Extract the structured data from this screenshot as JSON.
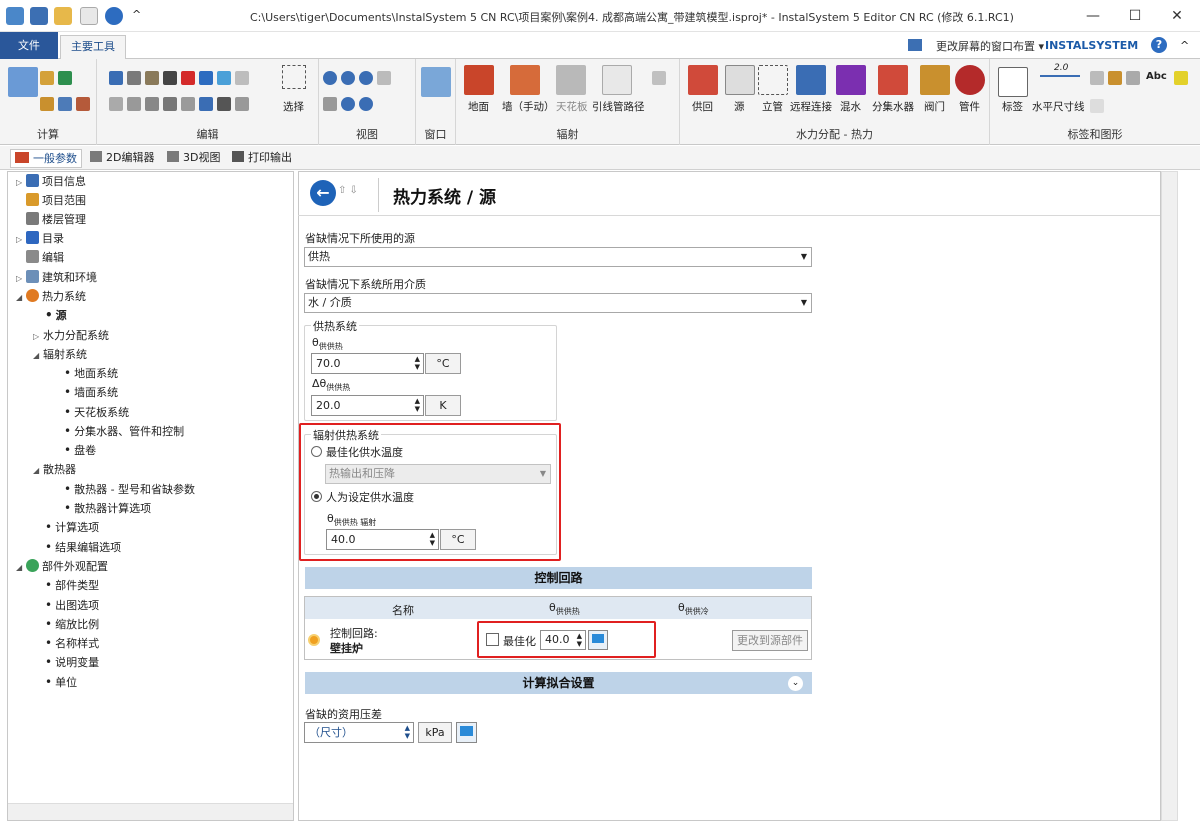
{
  "window": {
    "title": "C:\\Users\\tiger\\Documents\\InstalSystem 5 CN RC\\项目案例\\案例4. 成都高端公寓_带建筑模型.isproj* - InstalSystem 5 Editor CN RC (修改 6.1.RC1)",
    "minimize": "—",
    "maximize": "☐",
    "close": "✕"
  },
  "ribbon_tabs": {
    "file": "文件",
    "main": "主要工具"
  },
  "topright": {
    "layout": "更改屏幕的窗口布置 ▾",
    "logo": "INSTALSYSTEM",
    "help": "?",
    "collapse": "^"
  },
  "ribbon": {
    "groups": [
      "计算",
      "编辑",
      "视图",
      "窗口",
      "辐射",
      "水力分配 - 热力",
      "标签和图形"
    ],
    "edit_select": "选择",
    "radiant_buttons": [
      "地面",
      "墙（手动）",
      "天花板",
      "引线管路径"
    ],
    "hydraulic_buttons": [
      "供回",
      "源",
      "立管",
      "远程连接",
      "混水",
      "分集水器",
      "阀门",
      "管件"
    ],
    "label_buttons": [
      "标签",
      "水平尺寸线"
    ],
    "dim_value": "2.0",
    "abc": "Abc"
  },
  "doc_tabs": [
    "一般参数",
    "2D编辑器",
    "3D视图",
    "打印输出"
  ],
  "tree": [
    {
      "label": "项目信息",
      "toggle": "▷",
      "icon": "#3a6db4"
    },
    {
      "label": "项目范围",
      "toggle": "",
      "icon": "#d99a2b"
    },
    {
      "label": "楼层管理",
      "toggle": "",
      "icon": "#7a7a7a"
    },
    {
      "label": "目录",
      "toggle": "▷",
      "icon": "#2e67c0"
    },
    {
      "label": "编辑",
      "toggle": "",
      "icon": "#8a8a8a"
    },
    {
      "label": "建筑和环境",
      "toggle": "▷",
      "icon": "#6c8fb8"
    },
    {
      "label": "热力系统",
      "toggle": "◢",
      "icon": "#e07a22"
    },
    {
      "label": "源"
    },
    {
      "label": "水力分配系统",
      "toggle": "▷"
    },
    {
      "label": "辐射系统",
      "toggle": "◢"
    },
    {
      "label": "地面系统"
    },
    {
      "label": "墙面系统"
    },
    {
      "label": "天花板系统"
    },
    {
      "label": "分集水器、管件和控制"
    },
    {
      "label": "盘卷"
    },
    {
      "label": "散热器",
      "toggle": "◢"
    },
    {
      "label": "散热器 - 型号和省缺参数"
    },
    {
      "label": "散热器计算选项"
    },
    {
      "label": "计算选项"
    },
    {
      "label": "结果编辑选项"
    },
    {
      "label": "部件外观配置",
      "toggle": "◢",
      "icon": "#3aa35a"
    },
    {
      "label": "部件类型"
    },
    {
      "label": "出图选项"
    },
    {
      "label": "缩放比例"
    },
    {
      "label": "名称样式"
    },
    {
      "label": "说明变量"
    },
    {
      "label": "单位"
    }
  ],
  "page": {
    "title": "热力系统 / 源",
    "nav": "⇧ ⇩",
    "default_source_label": "省缺情况下所使用的源",
    "default_source_value": "供热",
    "default_medium_label": "省缺情况下系统所用介质",
    "default_medium_value": "水 / 介质",
    "heating_system_legend": "供热系统",
    "theta_supply_label": "θ",
    "theta_supply_sub": "供供热",
    "theta_supply_value": "70.0",
    "theta_supply_unit": "°C",
    "dtheta_label": "Δθ",
    "dtheta_sub": "供供热",
    "dtheta_value": "20.0",
    "dtheta_unit": "K",
    "radiant_legend": "辐射供热系统",
    "opt_optimize": "最佳化供水温度",
    "opt_optimize_combo": "热输出和压降",
    "opt_manual": "人为设定供水温度",
    "theta_radiant_label": "θ",
    "theta_radiant_sub": "供供热 辐射",
    "theta_radiant_value": "40.0",
    "theta_radiant_unit": "°C",
    "control_section": "控制回路",
    "col_name": "名称",
    "col_supply": "θ",
    "col_supply_sub": "供供热",
    "col_return": "θ",
    "col_return_sub": "供供冷",
    "row_name1": "控制回路:",
    "row_name2": "壁挂炉",
    "row_optimize": "最佳化",
    "row_value": "40.0",
    "row_change_btn": "更改到源部件",
    "calc_section": "计算拟合设置",
    "pressure_label": "省缺的资用压差",
    "pressure_value": "（尺寸）",
    "pressure_unit": "kPa"
  }
}
